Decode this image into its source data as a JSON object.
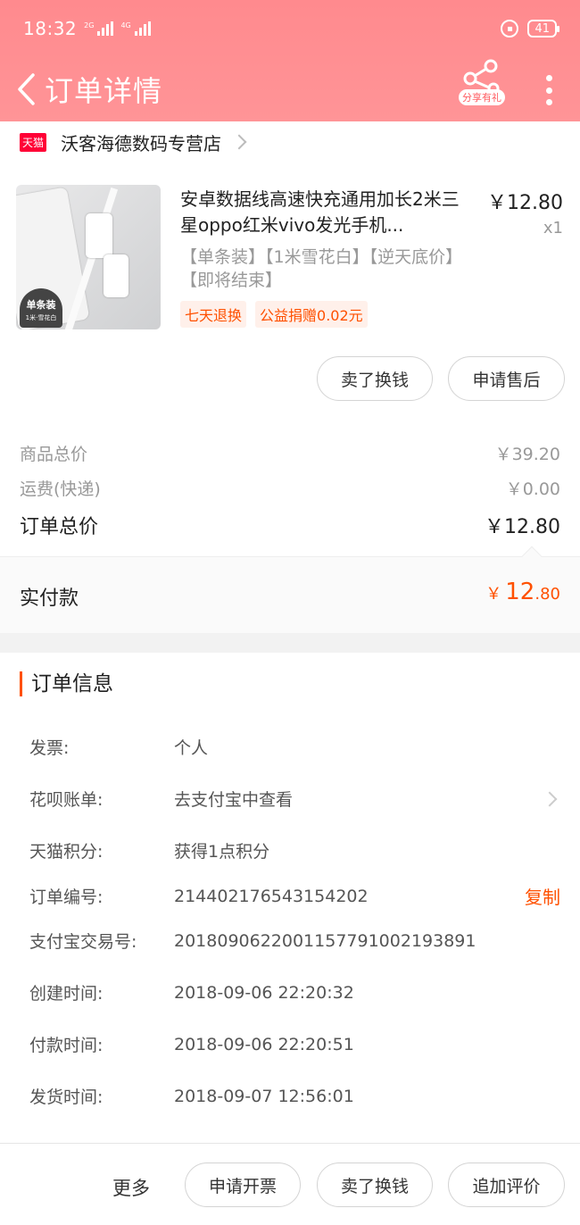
{
  "status_bar": {
    "time": "18:32",
    "net1": "2G",
    "net2": "4G",
    "battery": "41"
  },
  "header": {
    "title": "订单详情",
    "share_label": "分享有礼"
  },
  "shop": {
    "badge": "天猫",
    "name": "沃客海德数码专营店"
  },
  "product": {
    "title": "安卓数据线高速快充通用加长2米三星oppo红米vivo发光手机...",
    "price": "￥12.80",
    "qty": "x1",
    "sku": "【单条装】【1米雪花白】【逆天底价】【即将结束】",
    "thumb_tag": "单条装",
    "thumb_tag_sub": "1米·雪花白",
    "tags": [
      "七天退换",
      "公益捐赠0.02元"
    ]
  },
  "actions": {
    "sell": "卖了换钱",
    "after_sale": "申请售后"
  },
  "summary": {
    "goods_label": "商品总价",
    "goods_value": "￥39.20",
    "shipping_label": "运费(快递)",
    "shipping_value": "￥0.00",
    "total_label": "订单总价",
    "total_value": "￥12.80",
    "paid_label": "实付款",
    "paid_currency": "￥",
    "paid_int": "12",
    "paid_dec": ".80"
  },
  "order_info": {
    "title": "订单信息",
    "rows": [
      {
        "key": "发票:",
        "value": "个人"
      },
      {
        "key": "花呗账单:",
        "value": "去支付宝中查看"
      },
      {
        "key": "天猫积分:",
        "value": "获得1点积分"
      },
      {
        "key": "订单编号:",
        "value": "214402176543154202",
        "action": "复制"
      },
      {
        "key": "支付宝交易号:",
        "value": "2018090622001157791002193891"
      },
      {
        "key": "创建时间:",
        "value": "2018-09-06 22:20:32"
      },
      {
        "key": "付款时间:",
        "value": "2018-09-06 22:20:51"
      },
      {
        "key": "发货时间:",
        "value": "2018-09-07 12:56:01"
      }
    ]
  },
  "bottom_bar": {
    "more": "更多",
    "invoice": "申请开票",
    "sell": "卖了换钱",
    "review": "追加评价"
  },
  "colors": {
    "header": "#ff8a8e",
    "accent": "#ff5000",
    "tmall": "#ff0036"
  }
}
